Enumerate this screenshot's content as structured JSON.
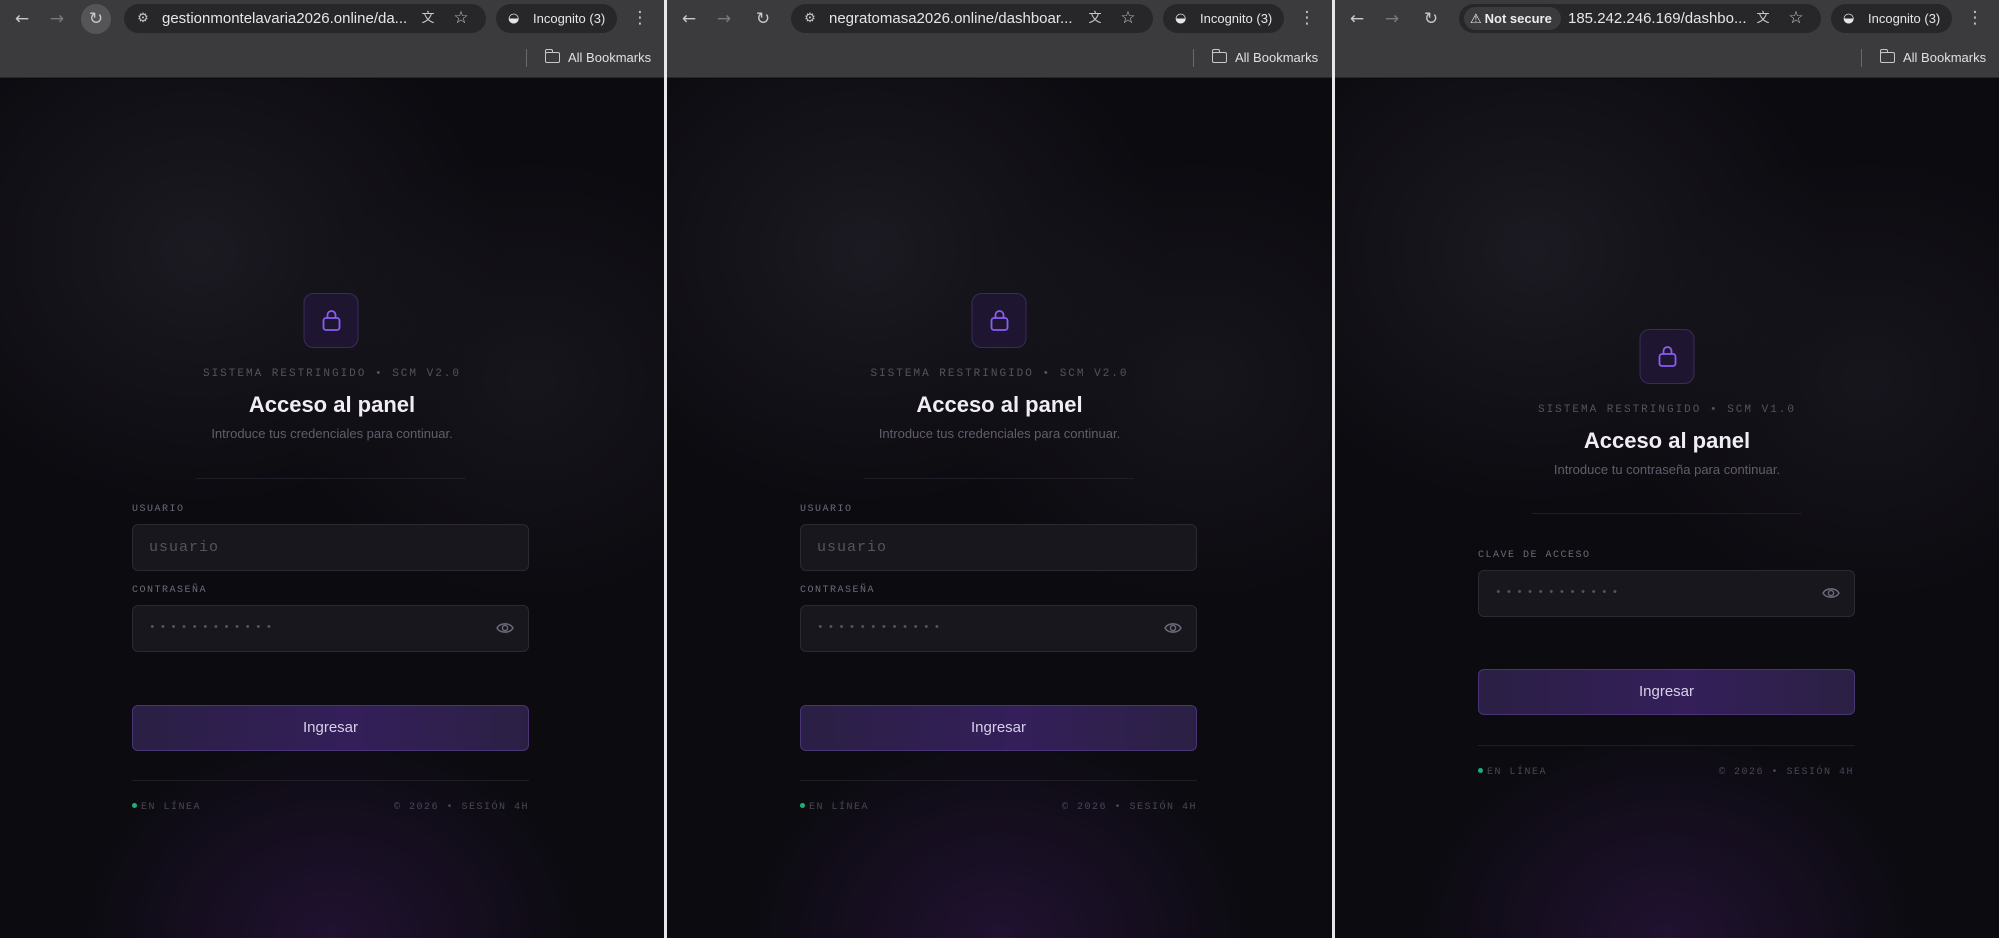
{
  "icons": {
    "back": "back-arrow-icon",
    "forward": "forward-arrow-icon",
    "reload": "reload-icon",
    "site_info": "site-settings-icon",
    "translate": "translate-icon",
    "bookmark": "star-icon",
    "incognito": "incognito-icon",
    "menu": "kebab-menu-icon",
    "folder": "folder-icon",
    "lock": "lock-icon",
    "eye": "eye-icon",
    "warning": "warning-icon"
  },
  "colors": {
    "accent": "#7c4dff",
    "online": "#1fae78",
    "background": "#0c0b10"
  },
  "windows": [
    {
      "url": "gestionmontelavaria2026.online/da...",
      "incognito_label": "Incognito (3)",
      "bookmarks_label": "All Bookmarks",
      "kicker": "SISTEMA RESTRINGIDO  •  SCM V2.0",
      "title": "Acceso al panel",
      "subtitle": "Introduce tus credenciales para continuar.",
      "user_label": "USUARIO",
      "user_placeholder": "usuario",
      "password_label": "CONTRASEÑA",
      "password_mask": "••••••••••••",
      "submit_label": "Ingresar",
      "status": "EN LÍNEA",
      "meta": "© 2026  •  SESIÓN 4H"
    },
    {
      "url": "negratomasa2026.online/dashboar...",
      "incognito_label": "Incognito (3)",
      "bookmarks_label": "All Bookmarks",
      "kicker": "SISTEMA RESTRINGIDO  •  SCM V2.0",
      "title": "Acceso al panel",
      "subtitle": "Introduce tus credenciales para continuar.",
      "user_label": "USUARIO",
      "user_placeholder": "usuario",
      "password_label": "CONTRASEÑA",
      "password_mask": "••••••••••••",
      "submit_label": "Ingresar",
      "status": "EN LÍNEA",
      "meta": "© 2026  •  SESIÓN 4H"
    },
    {
      "security_label": "Not secure",
      "url": "185.242.246.169/dashbo...",
      "incognito_label": "Incognito (3)",
      "bookmarks_label": "All Bookmarks",
      "kicker": "SISTEMA RESTRINGIDO  •  SCM V1.0",
      "title": "Acceso al panel",
      "subtitle": "Introduce tu contraseña para continuar.",
      "password_label": "CLAVE DE ACCESO",
      "password_mask": "••••••••••••",
      "submit_label": "Ingresar",
      "status": "EN LÍNEA",
      "meta": "© 2026  •  SESIÓN 4H"
    }
  ]
}
